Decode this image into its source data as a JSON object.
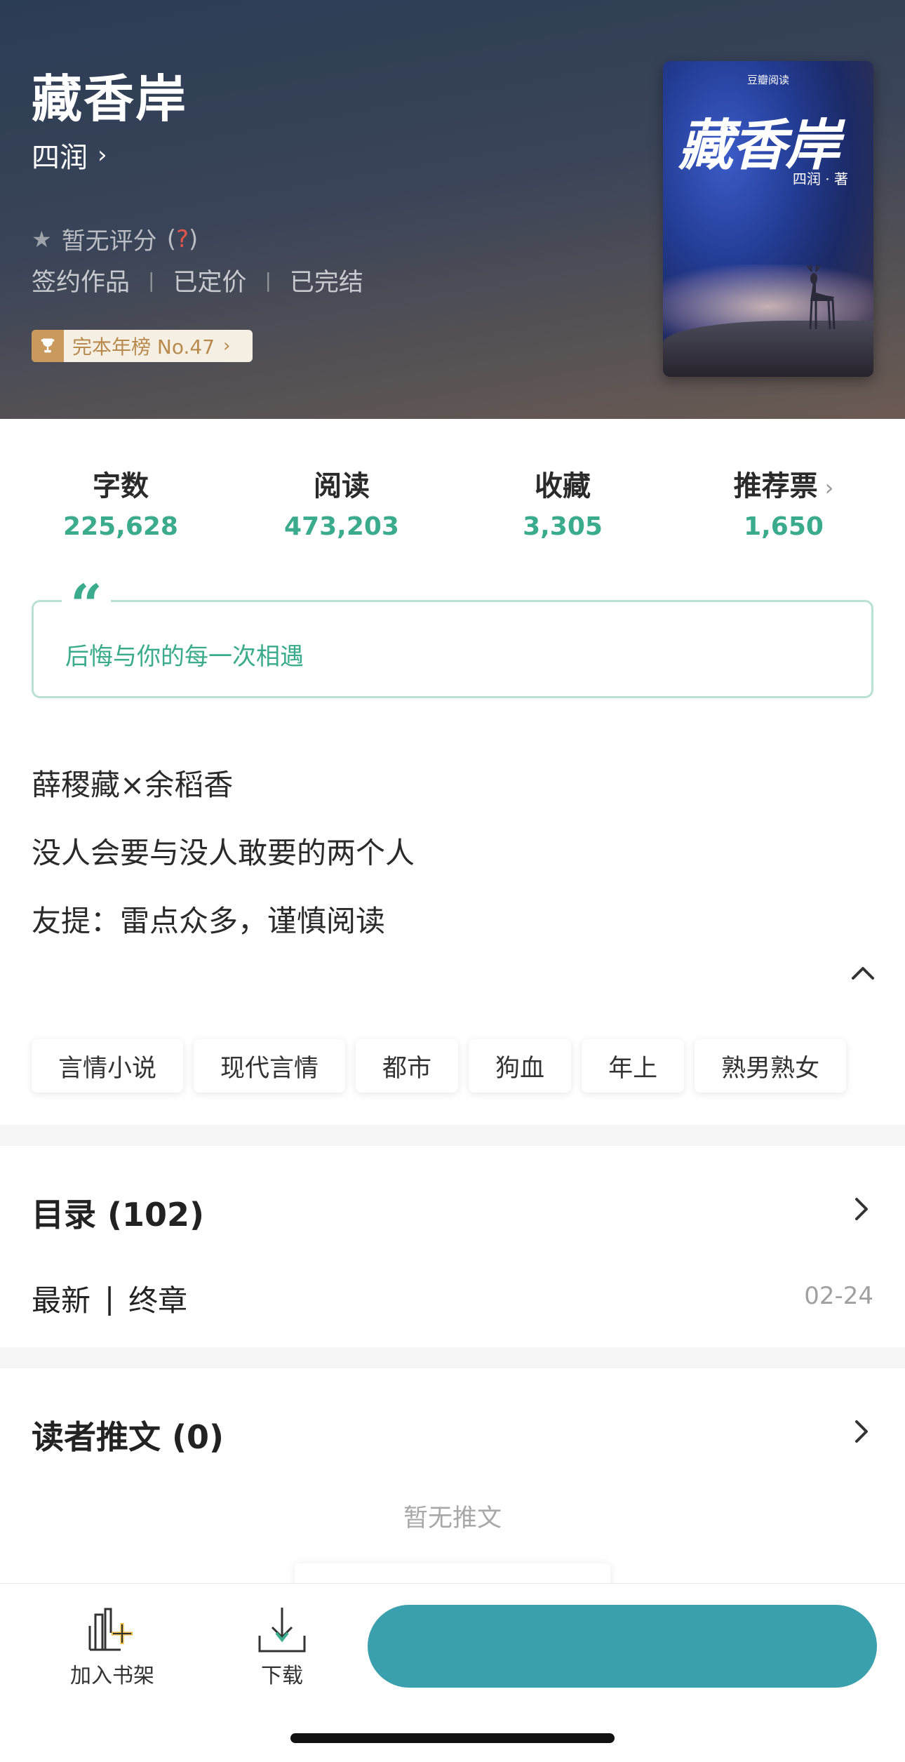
{
  "book": {
    "title": "藏香岸",
    "author": "四润",
    "rating_text": "暂无评分",
    "rating_help": "?",
    "status_tags": [
      "签约作品",
      "已定价",
      "已完结"
    ],
    "rank_label": "完本年榜 No.47",
    "cover": {
      "publisher": "豆瓣阅读",
      "title": "藏香岸",
      "author": "四润 · 著"
    }
  },
  "stats": [
    {
      "label": "字数",
      "value": "225,628"
    },
    {
      "label": "阅读",
      "value": "473,203"
    },
    {
      "label": "收藏",
      "value": "3,305"
    },
    {
      "label": "推荐票",
      "value": "1,650"
    }
  ],
  "quote": "后悔与你的每一次相遇",
  "intro": [
    "薛稷藏×余稻香",
    "没人会要与没人敢要的两个人",
    "友提：雷点众多，谨慎阅读"
  ],
  "tags": [
    "言情小说",
    "现代言情",
    "都市",
    "狗血",
    "年上",
    "熟男熟女"
  ],
  "toc": {
    "title": "目录 (102)",
    "latest_label": "最新",
    "latest_chapter": "终章",
    "latest_date": "02-24"
  },
  "reviews": {
    "title": "读者推文 (0)",
    "empty_text": "暂无推文"
  },
  "bottom_bar": {
    "add_shelf": "加入书架",
    "download": "下载",
    "read_label": ""
  },
  "colors": {
    "accent": "#3aab8c",
    "read_button": "#3aa0ad"
  },
  "icons": {
    "star": "star-icon",
    "trophy": "trophy-icon",
    "collapse": "chevron-up-icon",
    "chevron": "chevron-right-icon",
    "shelf": "add-to-shelf-icon",
    "download": "download-icon"
  }
}
